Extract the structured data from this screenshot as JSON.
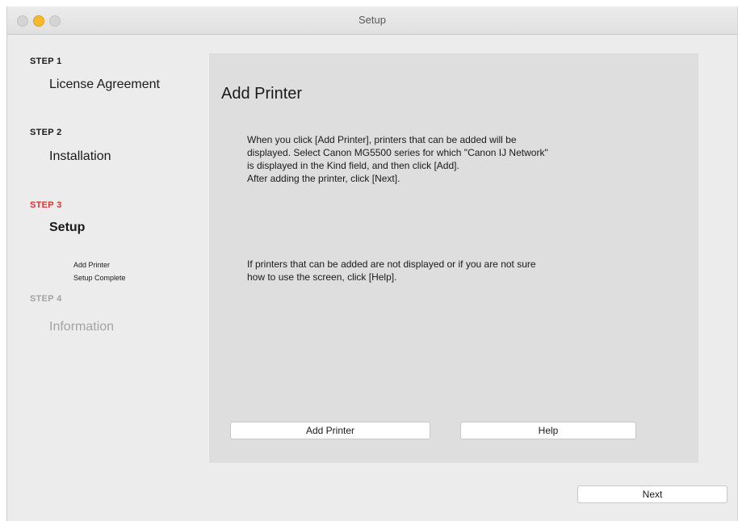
{
  "window": {
    "title": "Setup"
  },
  "steps": [
    {
      "label": "STEP 1",
      "title": "License Agreement"
    },
    {
      "label": "STEP 2",
      "title": "Installation"
    },
    {
      "label": "STEP 3",
      "title": "Setup",
      "substeps": [
        "Add Printer",
        "Setup Complete"
      ]
    },
    {
      "label": "STEP 4",
      "title": "Information"
    }
  ],
  "main": {
    "heading": "Add Printer",
    "paragraph1": [
      "When you click [Add Printer], printers that can be added will be",
      "displayed. Select Canon MG5500 series for which \"Canon IJ Network\"",
      "is displayed in the Kind field, and then click [Add].",
      "After adding the printer, click [Next]."
    ],
    "paragraph2": [
      "If printers that can be added are not displayed or if you are not sure",
      "how to use the screen, click [Help]."
    ],
    "add_printer_button": "Add Printer",
    "help_button": "Help"
  },
  "footer": {
    "next_button": "Next"
  },
  "colors": {
    "active_step": "#e0332e",
    "inactive_step": "#a3a3a3"
  }
}
